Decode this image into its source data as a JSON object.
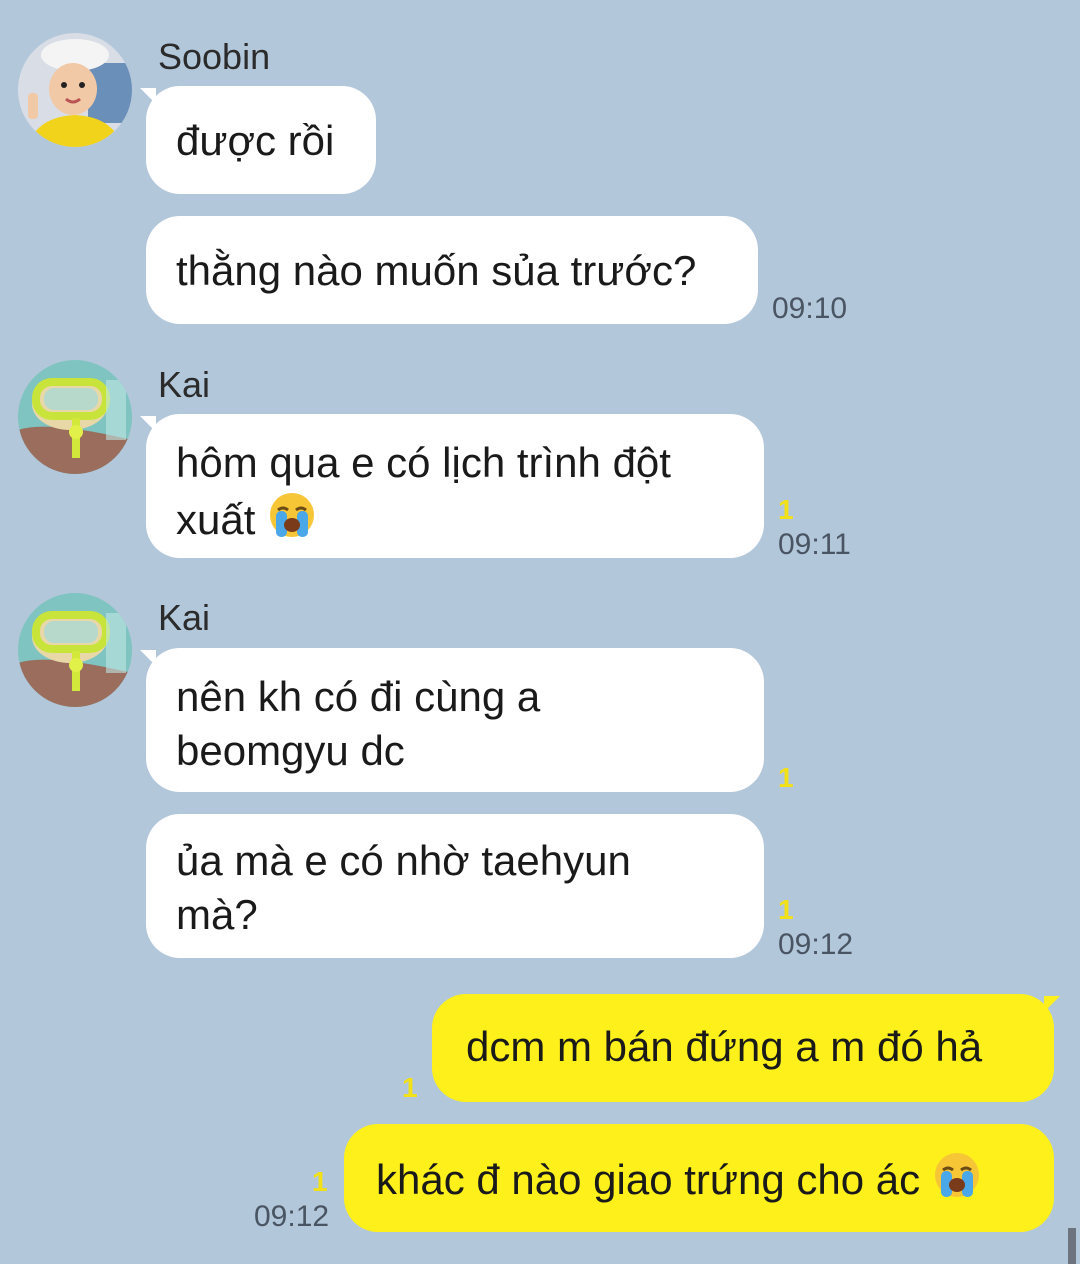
{
  "messages": [
    {
      "sender": "Soobin",
      "text": "được rồi"
    },
    {
      "text": "thằng nào muốn sủa trước?",
      "time": "09:10"
    },
    {
      "sender": "Kai",
      "line1": "hôm qua e có lịch trình đột",
      "line2": "xuất",
      "unread": "1",
      "time": "09:11"
    },
    {
      "sender": "Kai",
      "line1": "nên kh có đi cùng a",
      "line2": "beomgyu dc",
      "unread": "1"
    },
    {
      "line1": "ủa mà e có nhờ taehyun",
      "line2": "mà?",
      "unread": "1",
      "time": "09:12"
    },
    {
      "text": "dcm m bán đứng a m đó hả",
      "unread": "1"
    },
    {
      "text": "khác đ nào giao trứng cho ác",
      "unread": "1",
      "time": "09:12"
    }
  ],
  "icons": {
    "crying_emoji": "loudly-crying-face-icon"
  },
  "colors": {
    "background": "#b2c7da",
    "outgoing": "#fef01b",
    "incoming": "#ffffff",
    "unread": "#f2e116"
  }
}
